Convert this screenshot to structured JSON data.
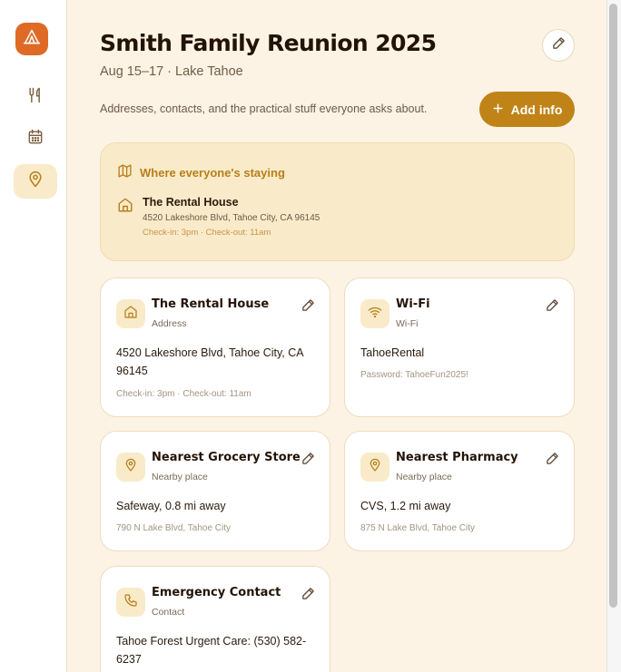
{
  "sidebar": {
    "logo_icon": "tent-icon",
    "items": [
      {
        "icon": "utensils-icon",
        "active": false
      },
      {
        "icon": "calendar-icon",
        "active": false
      },
      {
        "icon": "map-pin-icon",
        "active": true
      }
    ]
  },
  "header": {
    "title": "Smith Family Reunion 2025",
    "subtitle": "Aug 15–17 · Lake Tahoe",
    "description": "Addresses, contacts, and the practical stuff everyone asks about.",
    "add_button_label": "Add info"
  },
  "staying": {
    "heading": "Where everyone's staying",
    "name": "The Rental House",
    "address": "4520 Lakeshore Blvd, Tahoe City, CA 96145",
    "checkin": "Check-in: 3pm · Check-out: 11am"
  },
  "cards": [
    {
      "title": "The Rental House",
      "type": "Address",
      "value": "4520 Lakeshore Blvd, Tahoe City, CA 96145",
      "note": "Check-in: 3pm · Check-out: 11am",
      "icon": "house-icon"
    },
    {
      "title": "Wi-Fi",
      "type": "Wi-Fi",
      "value": "TahoeRental",
      "note": "Password: TahoeFun2025!",
      "icon": "wifi-icon"
    },
    {
      "title": "Nearest Grocery Store",
      "type": "Nearby place",
      "value": "Safeway, 0.8 mi away",
      "note": "790 N Lake Blvd, Tahoe City",
      "icon": "map-pin-icon"
    },
    {
      "title": "Nearest Pharmacy",
      "type": "Nearby place",
      "value": "CVS, 1.2 mi away",
      "note": "875 N Lake Blvd, Tahoe City",
      "icon": "map-pin-icon"
    },
    {
      "title": "Emergency Contact",
      "type": "Contact",
      "value": "Tahoe Forest Urgent Care: (530) 582-6237",
      "note": "",
      "icon": "phone-icon"
    }
  ],
  "colors": {
    "accent": "#df6a25",
    "button": "#c08317",
    "background": "#fdf3e4",
    "panel": "#f9ebc9"
  }
}
